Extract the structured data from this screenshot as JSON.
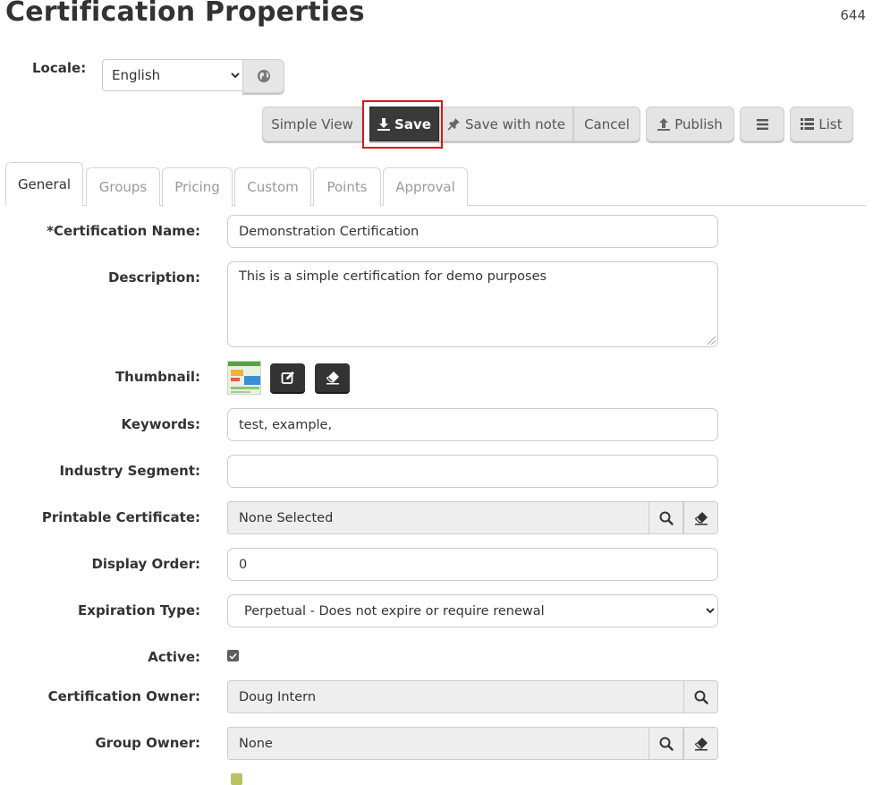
{
  "page": {
    "title": "Certification Properties",
    "record_id": "644"
  },
  "locale": {
    "label": "Locale:",
    "selected": "English",
    "globe_icon": "globe-icon"
  },
  "toolbar": {
    "simple_view": "Simple View",
    "save": "Save",
    "save_with_note": "Save with note",
    "cancel": "Cancel",
    "publish": "Publish",
    "menu_icon": "bars-icon",
    "list": "List",
    "highlighted_button": "Save",
    "highlight_color": "#d9161c"
  },
  "tabs": [
    {
      "label": "General",
      "active": true
    },
    {
      "label": "Groups",
      "active": false
    },
    {
      "label": "Pricing",
      "active": false
    },
    {
      "label": "Custom",
      "active": false
    },
    {
      "label": "Points",
      "active": false
    },
    {
      "label": "Approval",
      "active": false
    }
  ],
  "form": {
    "certification_name": {
      "label": "*Certification Name:",
      "value": "Demonstration Certification"
    },
    "description": {
      "label": "Description:",
      "value": "This is a simple certification for demo purposes"
    },
    "thumbnail": {
      "label": "Thumbnail:"
    },
    "keywords": {
      "label": "Keywords:",
      "value": "test, example,"
    },
    "industry_segment": {
      "label": "Industry Segment:",
      "value": ""
    },
    "printable_certificate": {
      "label": "Printable Certificate:",
      "value": "None Selected"
    },
    "display_order": {
      "label": "Display Order:",
      "value": "0"
    },
    "expiration_type": {
      "label": "Expiration Type:",
      "value": "Perpetual - Does not expire or require renewal"
    },
    "active": {
      "label": "Active:",
      "checked": true
    },
    "certification_owner": {
      "label": "Certification Owner:",
      "value": "Doug Intern"
    },
    "group_owner": {
      "label": "Group Owner:",
      "value": "None"
    }
  },
  "colors": {
    "dark_button": "#3a3a3a",
    "light_button": "#e4e4e4",
    "readonly_field": "#eeeeee"
  }
}
